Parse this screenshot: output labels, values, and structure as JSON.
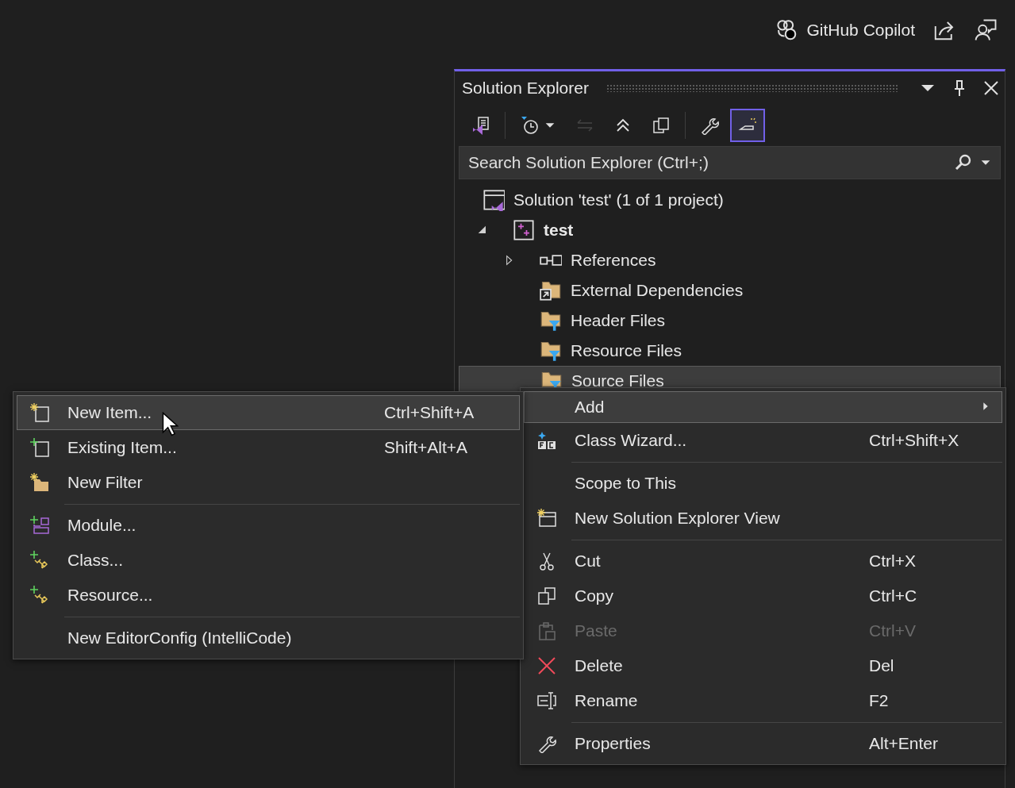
{
  "top_bar": {
    "copilot_label": "GitHub Copilot"
  },
  "solution_explorer": {
    "title": "Solution Explorer",
    "toolbar": [
      {
        "selected": false,
        "disabled": false
      },
      {
        "selected": false,
        "disabled": false
      },
      {
        "selected": false,
        "disabled": true
      },
      {
        "selected": false,
        "disabled": false
      },
      {
        "selected": false,
        "disabled": false
      },
      {
        "selected": false,
        "disabled": false
      },
      {
        "selected": true,
        "disabled": false
      }
    ],
    "search": {
      "placeholder": "Search Solution Explorer (Ctrl+;)"
    },
    "tree": [
      {
        "label": "Solution 'test' (1 of 1 project)",
        "selected": false,
        "children": [
          {
            "label": "test",
            "startup": true,
            "expanded": true,
            "selected": false,
            "children": [
              {
                "label": "References",
                "expanded": false,
                "selected": false
              },
              {
                "label": "External Dependencies",
                "selected": false
              },
              {
                "label": "Header Files",
                "selected": false
              },
              {
                "label": "Resource Files",
                "selected": false
              },
              {
                "label": "Source Files",
                "selected": true
              }
            ]
          }
        ]
      }
    ]
  },
  "context_menu": {
    "items": [
      {
        "kind": "item",
        "label": "Add",
        "submenu": true,
        "selected": true,
        "disabled": false
      },
      {
        "kind": "item",
        "label": "Class Wizard...",
        "shortcut": "Ctrl+Shift+X",
        "selected": false,
        "disabled": false
      },
      {
        "kind": "separator"
      },
      {
        "kind": "item",
        "label": "Scope to This",
        "selected": false,
        "disabled": false
      },
      {
        "kind": "item",
        "label": "New Solution Explorer View",
        "selected": false,
        "disabled": false
      },
      {
        "kind": "separator"
      },
      {
        "kind": "item",
        "label": "Cut",
        "shortcut": "Ctrl+X",
        "selected": false,
        "disabled": false
      },
      {
        "kind": "item",
        "label": "Copy",
        "shortcut": "Ctrl+C",
        "selected": false,
        "disabled": false
      },
      {
        "kind": "item",
        "label": "Paste",
        "shortcut": "Ctrl+V",
        "selected": false,
        "disabled": true
      },
      {
        "kind": "item",
        "label": "Delete",
        "shortcut": "Del",
        "selected": false,
        "disabled": false
      },
      {
        "kind": "item",
        "label": "Rename",
        "shortcut": "F2",
        "selected": false,
        "disabled": false
      },
      {
        "kind": "separator"
      },
      {
        "kind": "item",
        "label": "Properties",
        "shortcut": "Alt+Enter",
        "selected": false,
        "disabled": false
      }
    ]
  },
  "add_submenu": {
    "items": [
      {
        "kind": "item",
        "label": "New Item...",
        "shortcut": "Ctrl+Shift+A",
        "selected": true,
        "disabled": false
      },
      {
        "kind": "item",
        "label": "Existing Item...",
        "shortcut": "Shift+Alt+A",
        "selected": false,
        "disabled": false
      },
      {
        "kind": "item",
        "label": "New Filter",
        "selected": false,
        "disabled": false
      },
      {
        "kind": "separator"
      },
      {
        "kind": "item",
        "label": "Module...",
        "selected": false,
        "disabled": false
      },
      {
        "kind": "item",
        "label": "Class...",
        "selected": false,
        "disabled": false
      },
      {
        "kind": "item",
        "label": "Resource...",
        "selected": false,
        "disabled": false
      },
      {
        "kind": "separator"
      },
      {
        "kind": "item",
        "label": "New EditorConfig (IntelliCode)",
        "selected": false,
        "disabled": false
      }
    ]
  }
}
